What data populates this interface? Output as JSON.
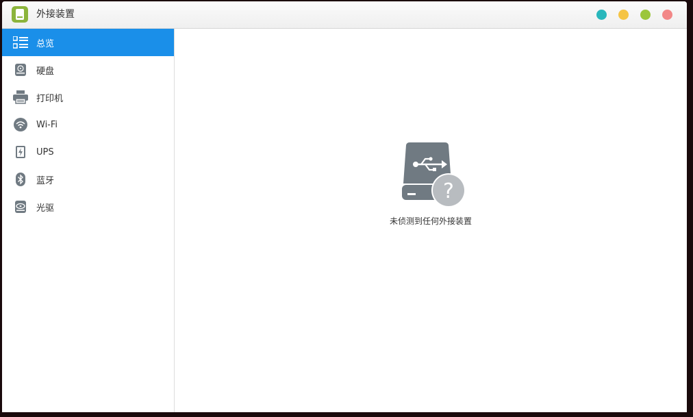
{
  "window": {
    "title": "外接装置",
    "controls": [
      {
        "name": "help-button",
        "color": "#2ab7bc"
      },
      {
        "name": "minimize-button",
        "color": "#f5c445"
      },
      {
        "name": "maximize-button",
        "color": "#9cc63a"
      },
      {
        "name": "close-button",
        "color": "#f28787"
      }
    ]
  },
  "sidebar": {
    "items": [
      {
        "label": "总览",
        "icon": "overview-list-icon",
        "active": true
      },
      {
        "label": "硬盘",
        "icon": "hard-disk-icon",
        "active": false
      },
      {
        "label": "打印机",
        "icon": "printer-icon",
        "active": false
      },
      {
        "label": "Wi-Fi",
        "icon": "wifi-icon",
        "active": false
      },
      {
        "label": "UPS",
        "icon": "ups-icon",
        "active": false
      },
      {
        "label": "蓝牙",
        "icon": "bluetooth-icon",
        "active": false
      },
      {
        "label": "光驱",
        "icon": "optical-drive-icon",
        "active": false
      }
    ]
  },
  "main": {
    "empty_icon": "usb-device-unknown-icon",
    "empty_message": "未侦测到任何外接装置"
  },
  "colors": {
    "accent": "#1a8fe9",
    "icon_gray": "#707a82",
    "brand_green": "#8cb43b"
  }
}
